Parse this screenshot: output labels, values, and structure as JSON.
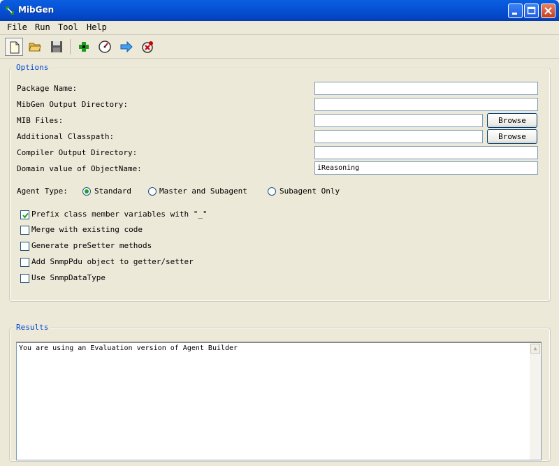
{
  "window": {
    "title": "MibGen"
  },
  "menu": [
    "File",
    "Run",
    "Tool",
    "Help"
  ],
  "toolbar": [
    "new-file-icon",
    "open-folder-icon",
    "save-icon",
    "add-icon",
    "gauge-icon",
    "arrow-right-icon",
    "stop-icon"
  ],
  "options": {
    "legend": "Options",
    "fields": [
      {
        "label": "Package Name:",
        "value": ""
      },
      {
        "label": "MibGen Output Directory:",
        "value": ""
      },
      {
        "label": "MIB Files:",
        "value": "",
        "button": "Browse"
      },
      {
        "label": "Additional Classpath:",
        "value": "",
        "button": "Browse"
      },
      {
        "label": "Compiler Output Directory:",
        "value": ""
      },
      {
        "label": "Domain value of ObjectName:",
        "value": "iReasoning"
      }
    ],
    "agent_type": {
      "label": "Agent Type:",
      "options": [
        "Standard",
        "Master and Subagent",
        "Subagent Only"
      ],
      "selected": "Standard"
    },
    "checkboxes": [
      {
        "label": "Prefix class member variables with \"_\"",
        "checked": true
      },
      {
        "label": "Merge with existing code",
        "checked": false
      },
      {
        "label": "Generate preSetter methods",
        "checked": false
      },
      {
        "label": "Add SnmpPdu object to getter/setter",
        "checked": false
      },
      {
        "label": "Use SnmpDataType",
        "checked": false
      }
    ]
  },
  "results": {
    "legend": "Results",
    "text": "You are using an Evaluation version of Agent Builder"
  }
}
